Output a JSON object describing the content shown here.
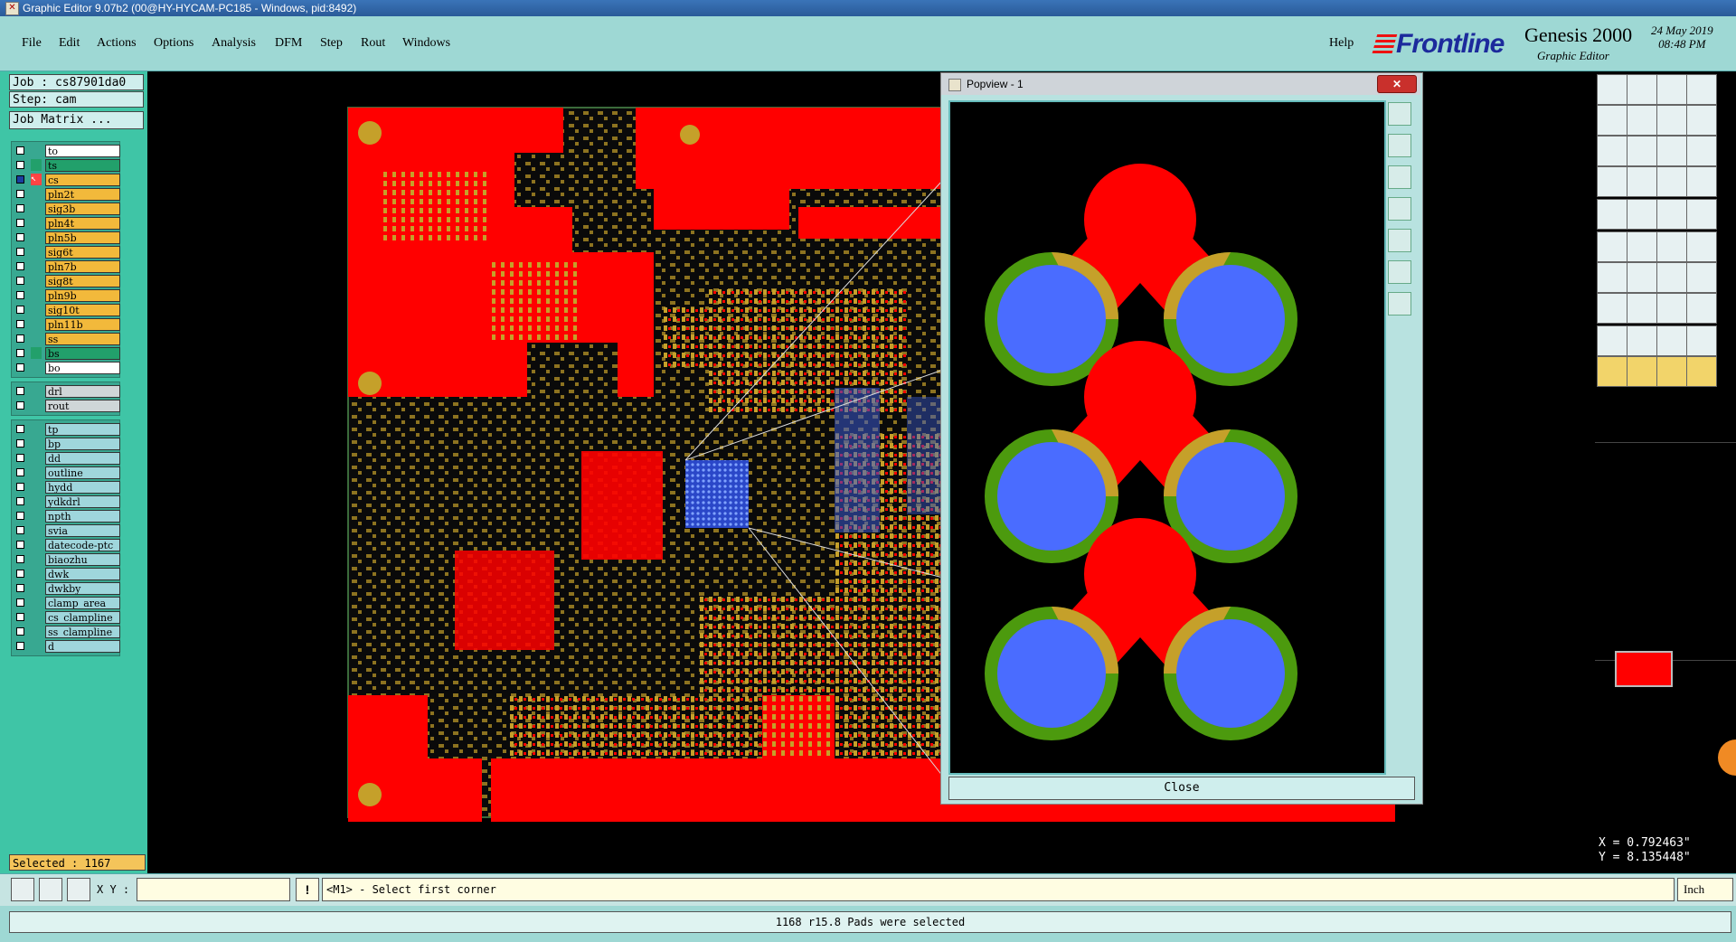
{
  "window": {
    "title": "Graphic Editor 9.07b2 (00@HY-HYCAM-PC185 - Windows, pid:8492)"
  },
  "menu": [
    "File",
    "Edit",
    "Actions",
    "Options",
    "Analysis",
    "DFM",
    "Step",
    "Rout",
    "Windows"
  ],
  "help": "Help",
  "brand": {
    "logo": "Frontline",
    "product": "Genesis 2000",
    "subtitle": "Graphic Editor",
    "date": "24 May 2019",
    "time": "08:48 PM"
  },
  "job": {
    "job": "Job : cs87901da0",
    "step": "Step: cam",
    "matrix": "Job Matrix ..."
  },
  "layers_board": [
    {
      "name": "to",
      "color": "#ffffff",
      "work": false
    },
    {
      "name": "ts",
      "color": "#22a06b",
      "work": false
    },
    {
      "name": "cs",
      "color": "#f2b93b",
      "work": true
    },
    {
      "name": "pln2t",
      "color": "#f2b93b"
    },
    {
      "name": "sig3b",
      "color": "#f2b93b"
    },
    {
      "name": "pln4t",
      "color": "#f2b93b"
    },
    {
      "name": "pln5b",
      "color": "#f2b93b"
    },
    {
      "name": "sig6t",
      "color": "#f2b93b"
    },
    {
      "name": "pln7b",
      "color": "#f2b93b"
    },
    {
      "name": "sig8t",
      "color": "#f2b93b"
    },
    {
      "name": "pln9b",
      "color": "#f2b93b"
    },
    {
      "name": "sig10t",
      "color": "#f2b93b"
    },
    {
      "name": "pln11b",
      "color": "#f2b93b"
    },
    {
      "name": "ss",
      "color": "#f2b93b"
    },
    {
      "name": "bs",
      "color": "#22a06b"
    },
    {
      "name": "bo",
      "color": "#ffffff"
    }
  ],
  "layers_drill": [
    {
      "name": "drl",
      "color": "#cfd6d8"
    },
    {
      "name": "rout",
      "color": "#cfd6d8"
    }
  ],
  "layers_misc": [
    {
      "name": "tp",
      "color": "#9fd6dc"
    },
    {
      "name": "bp",
      "color": "#9fd6dc"
    },
    {
      "name": "dd",
      "color": "#9fd6dc"
    },
    {
      "name": "outline",
      "color": "#9fd6dc"
    },
    {
      "name": "hydd",
      "color": "#9fd6dc"
    },
    {
      "name": "ydkdrl",
      "color": "#9fd6dc"
    },
    {
      "name": "npth",
      "color": "#9fd6dc"
    },
    {
      "name": "svia",
      "color": "#9fd6dc"
    },
    {
      "name": "datecode-ptc",
      "color": "#9fd6dc"
    },
    {
      "name": "biaozhu",
      "color": "#9fd6dc"
    },
    {
      "name": "dwk",
      "color": "#9fd6dc"
    },
    {
      "name": "dwkby",
      "color": "#9fd6dc"
    },
    {
      "name": "clamp_area",
      "color": "#9fd6dc"
    },
    {
      "name": "cs_clampline",
      "color": "#9fd6dc"
    },
    {
      "name": "ss_clampline",
      "color": "#9fd6dc"
    },
    {
      "name": "d",
      "color": "#9fd6dc"
    }
  ],
  "selected": "Selected : 1167",
  "popview": {
    "title": "Popview - 1",
    "close": "Close"
  },
  "coords": {
    "x": "X = 0.792463\"",
    "y": "Y = 8.135448\""
  },
  "cmd": {
    "xy_label": "X Y :",
    "prompt": "<M1> - Select first corner",
    "unit": "Inch",
    "bang": "!"
  },
  "status": "1168 r15.8 Pads were selected",
  "colors": {
    "copper": "#ff0000",
    "pad": "#c5a02a",
    "drill": "#4a6cff",
    "ring": "#4c9a0e",
    "panel": "#3fc5a6",
    "menubar": "#9ed8d4"
  }
}
